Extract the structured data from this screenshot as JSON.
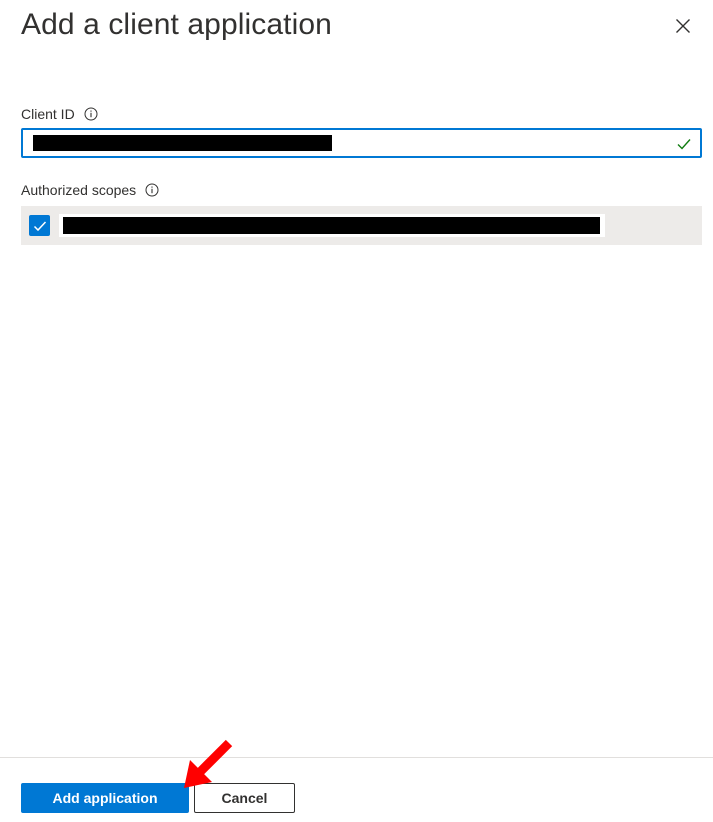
{
  "panel": {
    "title": "Add a client application"
  },
  "form": {
    "client_id": {
      "label": "Client ID",
      "value_redacted": true,
      "valid": true
    },
    "authorized_scopes": {
      "label": "Authorized scopes",
      "items": [
        {
          "checked": true,
          "value_redacted": true
        }
      ]
    }
  },
  "footer": {
    "primary_label": "Add application",
    "secondary_label": "Cancel"
  },
  "icons": {
    "close": "close-icon",
    "info": "info-icon",
    "valid": "checkmark-icon",
    "checkbox": "checkbox-checked-icon",
    "annotation": "red-arrow-icon"
  },
  "colors": {
    "accent": "#0078d4",
    "text": "#323130",
    "valid_check": "#107c10",
    "selected_row": "#edebe9",
    "annotation": "#ff0000"
  }
}
